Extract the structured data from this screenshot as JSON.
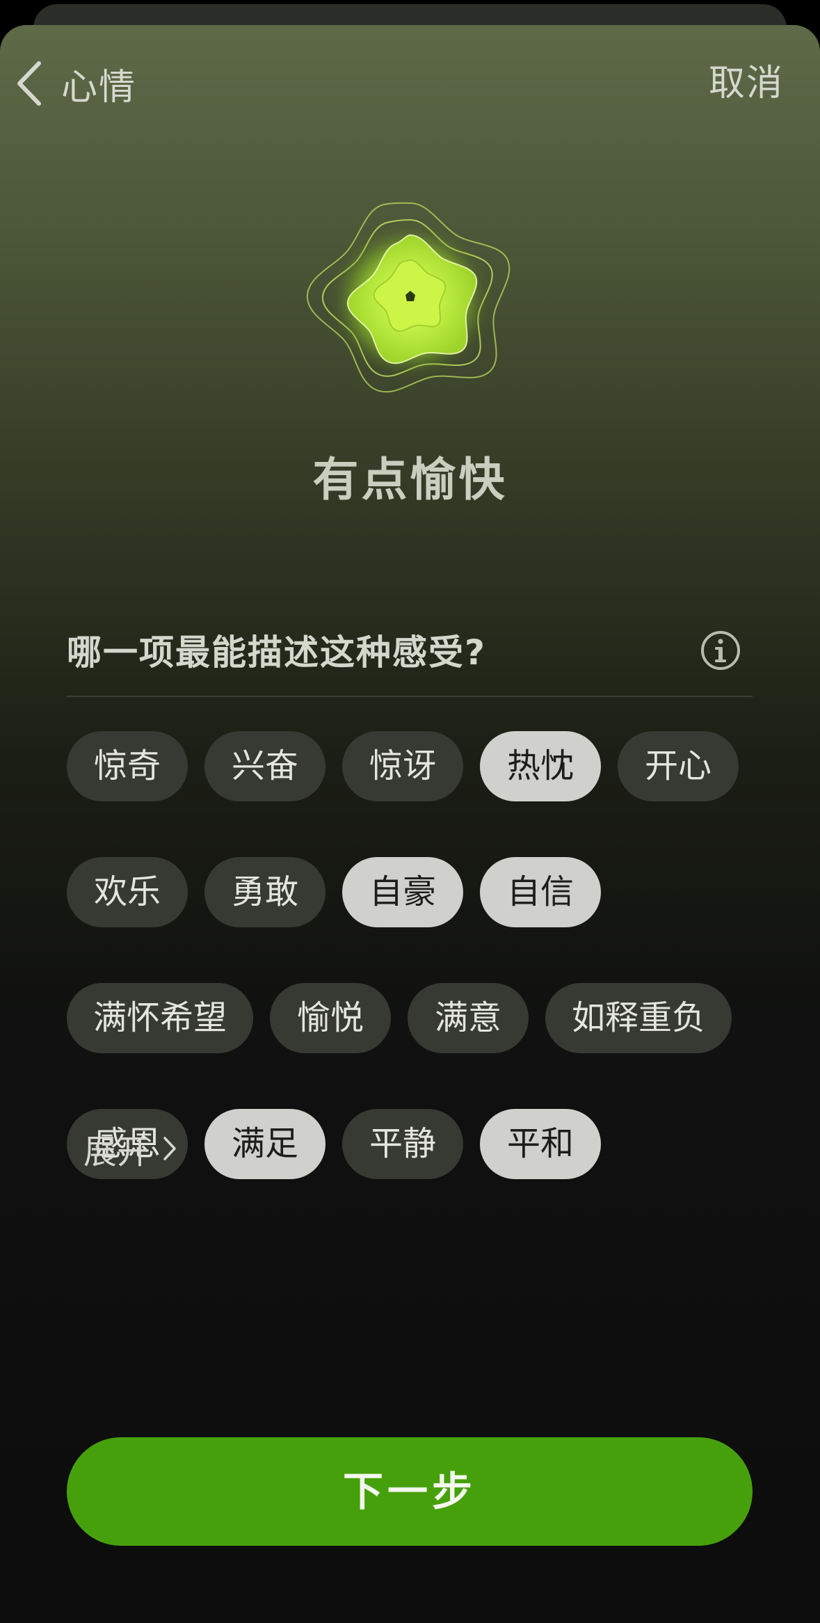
{
  "nav": {
    "back_label": "心情",
    "cancel_label": "取消"
  },
  "mood": {
    "title": "有点愉快",
    "emblem_icon": "glowing-star-flower-icon",
    "accent_color": "#b9f23a"
  },
  "question": {
    "text": "哪一项最能描述这种感受?",
    "info_icon": "info-icon"
  },
  "tags": [
    {
      "label": "惊奇",
      "selected": false
    },
    {
      "label": "兴奋",
      "selected": false
    },
    {
      "label": "惊讶",
      "selected": false
    },
    {
      "label": "热忱",
      "selected": true
    },
    {
      "label": "开心",
      "selected": false
    },
    {
      "label": "欢乐",
      "selected": false
    },
    {
      "label": "勇敢",
      "selected": false
    },
    {
      "label": "自豪",
      "selected": true
    },
    {
      "label": "自信",
      "selected": true
    },
    {
      "label": "满怀希望",
      "selected": false
    },
    {
      "label": "愉悦",
      "selected": false
    },
    {
      "label": "满意",
      "selected": false
    },
    {
      "label": "如释重负",
      "selected": false
    },
    {
      "label": "感恩",
      "selected": false
    },
    {
      "label": "满足",
      "selected": true
    },
    {
      "label": "平静",
      "selected": false
    },
    {
      "label": "平和",
      "selected": true
    }
  ],
  "expand": {
    "label": "展开"
  },
  "next_button": {
    "label": "下一步",
    "color": "#46a00b"
  },
  "colors": {
    "tag_default": "#373a33",
    "tag_selected": "#d0d0cd"
  }
}
